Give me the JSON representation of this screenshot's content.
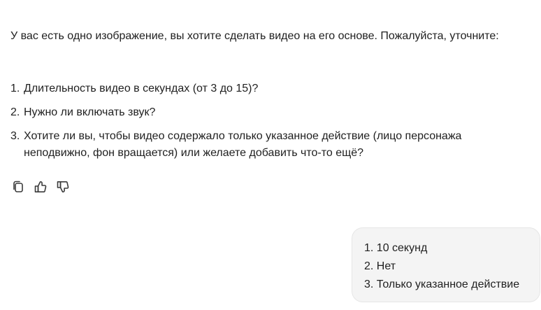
{
  "assistant": {
    "intro": "У вас есть одно изображение, вы хотите сделать видео на его основе. Пожалуйста, уточните:",
    "questions": [
      {
        "num": "1.",
        "text": "Длительность видео в секундах (от 3 до 15)?"
      },
      {
        "num": "2.",
        "text": "Нужно ли включать звук?"
      },
      {
        "num": "3.",
        "text": "Хотите ли вы, чтобы видео содержало только указанное действие (лицо персонажа неподвижно, фон вращается) или желаете добавить что-то ещё?"
      }
    ],
    "actions": {
      "copy_icon": "copy-icon",
      "like_icon": "thumbs-up-icon",
      "dislike_icon": "thumbs-down-icon"
    }
  },
  "user": {
    "lines": [
      "1. 10 секунд",
      "2. Нет",
      "3. Только указанное действие"
    ]
  },
  "colors": {
    "text": "#1f1f1f",
    "bubble_bg": "#f4f4f4",
    "icon": "#3a3a3a"
  }
}
